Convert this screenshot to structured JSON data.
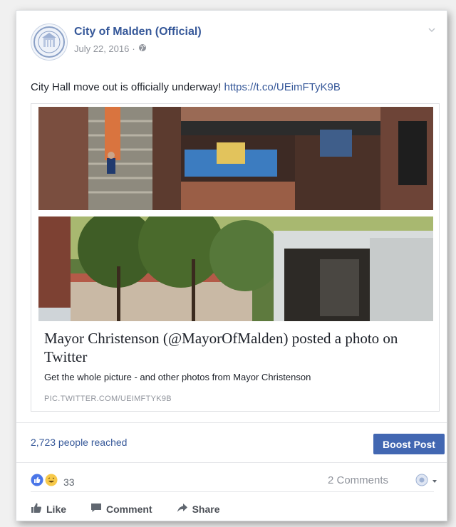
{
  "post": {
    "page_name": "City of Malden (Official)",
    "date": "July 22, 2016",
    "meta_separator": "·",
    "audience_icon": "globe-icon",
    "text_prefix": "City Hall move out is officially underway! ",
    "link_url": "https://t.co/UEimFTyK9B"
  },
  "link_preview": {
    "title": "Mayor Christenson (@MayorOfMalden) posted a photo on Twitter",
    "description": "Get the whole picture - and other photos from Mayor Christenson",
    "domain": "PIC.TWITTER.COM/UEIMFTYK9B"
  },
  "insights": {
    "reach": "2,723 people reached",
    "boost_label": "Boost Post"
  },
  "engagement": {
    "reaction_icons": [
      "like-icon",
      "haha-icon"
    ],
    "reaction_count": "33",
    "comments": "2 Comments"
  },
  "actions": [
    {
      "label": "Like",
      "icon": "thumbs-up-icon"
    },
    {
      "label": "Comment",
      "icon": "speech-bubble-icon"
    },
    {
      "label": "Share",
      "icon": "share-arrow-icon"
    }
  ],
  "colors": {
    "link": "#365899",
    "boost": "#4267b2",
    "muted": "#90949c"
  }
}
